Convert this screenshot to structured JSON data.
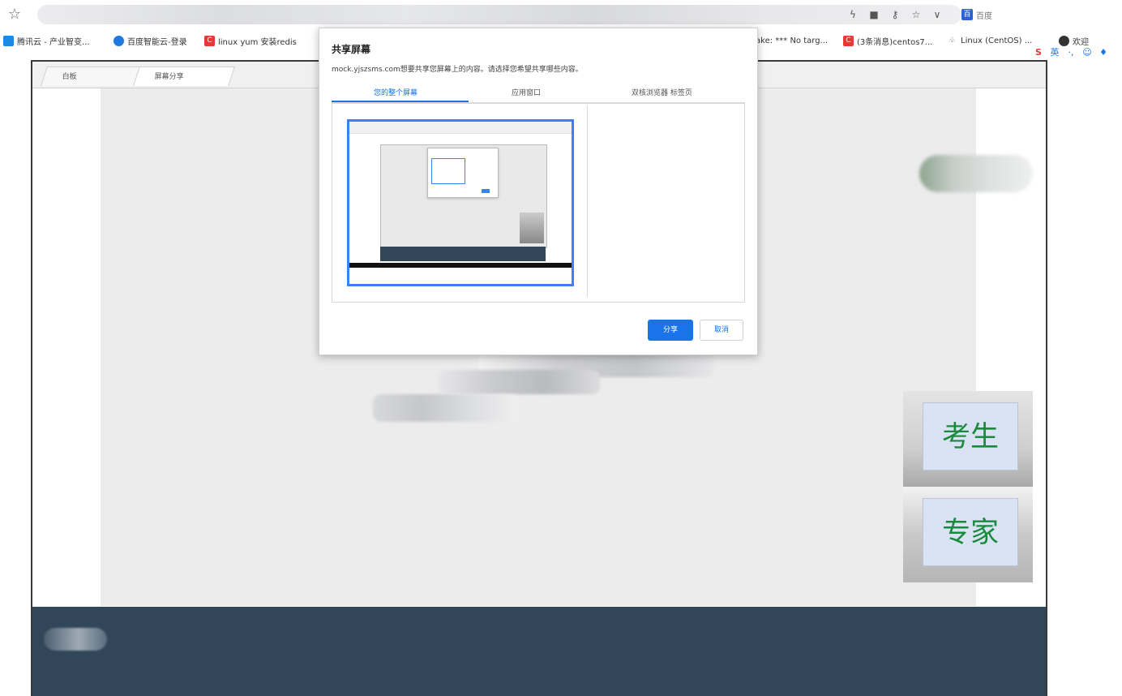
{
  "browser": {
    "address_url": "",
    "engine_label": "百度",
    "bookmarks": [
      {
        "label": "腾讯云 - 产业智变...",
        "icon": "cloud-icon",
        "color": "#1e88e5"
      },
      {
        "label": "百度智能云-登录",
        "icon": "baidu-cloud-icon",
        "color": "#1f7ae0"
      },
      {
        "label": "linux yum 安装redis",
        "icon": "csdn-icon",
        "color": "#e53935"
      },
      {
        "label": "ake: *** No targ...",
        "icon": "page-icon",
        "color": "#cccccc"
      },
      {
        "label": "(3条消息)centos7...",
        "icon": "csdn-icon",
        "color": "#e53935"
      },
      {
        "label": "Linux (CentOS) ...",
        "icon": "linux-icon",
        "color": "#777777"
      },
      {
        "label": "欢迎",
        "icon": "globe-icon",
        "color": "#333333"
      }
    ]
  },
  "app": {
    "tabs": [
      {
        "label": "白板",
        "active": false
      },
      {
        "label": "屏幕分享",
        "active": true
      }
    ],
    "video_tiles": [
      {
        "label": "考生"
      },
      {
        "label": "专家"
      }
    ]
  },
  "dialog": {
    "title": "共享屏幕",
    "description": "mock.yjszsms.com想要共享您屏幕上的内容。请选择您希望共享哪些内容。",
    "tabs": [
      {
        "label": "您的整个屏幕",
        "active": true
      },
      {
        "label": "应用窗口",
        "active": false
      },
      {
        "label": "双核浏览器 标签页",
        "active": false
      }
    ],
    "share_button": "分享",
    "cancel_button": "取消"
  },
  "colors": {
    "accent": "#1a73e8",
    "bottom_bar": "#32465a",
    "label_text": "#1a8a3d"
  }
}
